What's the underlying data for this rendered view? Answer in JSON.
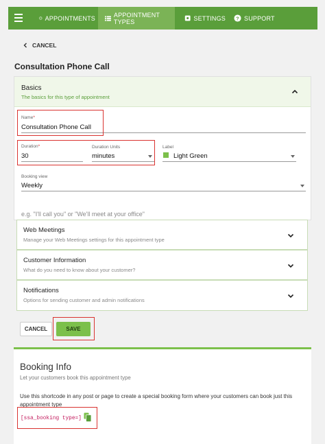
{
  "nav": {
    "items": [
      {
        "label": "APPOINTMENTS",
        "icon": "clock-icon"
      },
      {
        "label": "APPOINTMENT TYPES",
        "icon": "list-icon",
        "active": true
      },
      {
        "label": "SETTINGS",
        "icon": "gear-icon"
      },
      {
        "label": "SUPPORT",
        "icon": "help-icon"
      }
    ]
  },
  "cancel_link": "CANCEL",
  "page_title": "Consultation Phone Call",
  "basics": {
    "title": "Basics",
    "subtitle": "The basics for this type of appointment",
    "name": {
      "label": "Name",
      "value": "Consultation Phone Call"
    },
    "duration": {
      "label": "Duration",
      "value": "30"
    },
    "duration_units": {
      "label": "Duration Units",
      "value": "minutes"
    },
    "label": {
      "label": "Label",
      "value": "Light Green",
      "color": "#7cc04b"
    },
    "booking_view": {
      "label": "Booking view",
      "value": "Weekly"
    },
    "instructions_placeholder": "e.g. \"I'll call you\" or \"We'll meet at your office\""
  },
  "sections": [
    {
      "title": "Web Meetings",
      "subtitle": "Manage your Web Meetings settings for this appointment type"
    },
    {
      "title": "Customer Information",
      "subtitle": "What do you need to know about your customer?"
    },
    {
      "title": "Notifications",
      "subtitle": "Options for sending customer and admin notifications"
    }
  ],
  "buttons": {
    "cancel": "CANCEL",
    "save": "SAVE"
  },
  "booking_info": {
    "title": "Booking Info",
    "subtitle": "Let your customers book this appointment type",
    "description": "Use this shortcode in any post or page to create a special booking form where your customers can book just this appointment type",
    "shortcode": "[ssa_booking type=]"
  },
  "colors": {
    "brand": "#5a9e3a",
    "accent": "#7cc04b",
    "highlight": "#d9322f"
  }
}
